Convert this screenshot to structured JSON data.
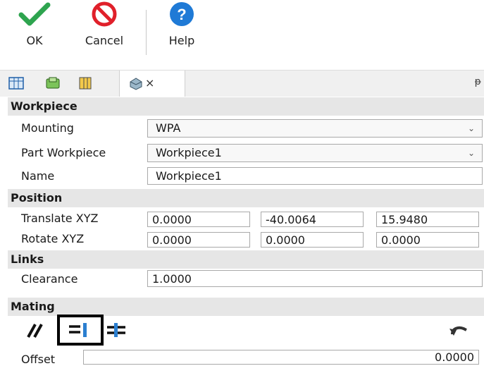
{
  "toolbar": {
    "ok_label": "OK",
    "cancel_label": "Cancel",
    "help_label": "Help"
  },
  "tabs": {
    "close_glyph": "×",
    "pin_glyph": "ᵽ"
  },
  "workpiece": {
    "title": "Workpiece",
    "mounting_label": "Mounting",
    "mounting_value": "WPA",
    "part_label": "Part Workpiece",
    "part_value": "Workpiece1",
    "name_label": "Name",
    "name_value": "Workpiece1"
  },
  "position": {
    "title": "Position",
    "translate_label": "Translate XYZ",
    "translate": [
      "0.0000",
      "-40.0064",
      "15.9480"
    ],
    "rotate_label": "Rotate XYZ",
    "rotate": [
      "0.0000",
      "0.0000",
      "0.0000"
    ]
  },
  "links": {
    "title": "Links",
    "clearance_label": "Clearance",
    "clearance_value": "1.0000"
  },
  "mating": {
    "title": "Mating",
    "offset_label": "Offset",
    "offset_value": "0.0000"
  },
  "colors": {
    "ok_green": "#2ea44f",
    "cancel_red": "#e0202a",
    "help_blue": "#1f7ad6",
    "section_bg": "#e6e6e6"
  }
}
